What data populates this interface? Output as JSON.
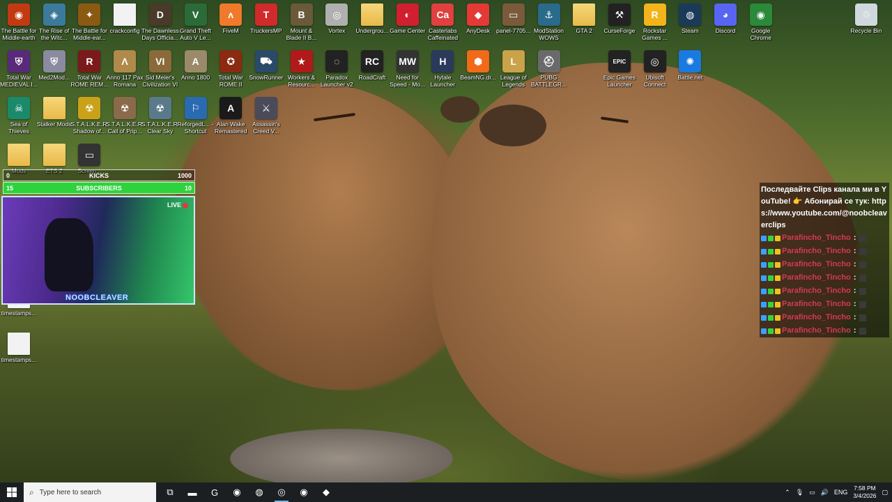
{
  "desktop": {
    "icons": [
      {
        "label": "The Battle for Middle-earth",
        "glyph": "◉",
        "color": "#c23a12"
      },
      {
        "label": "The Rise of the Witc...",
        "glyph": "◈",
        "color": "#3b7a9a"
      },
      {
        "label": "The Battle for Middle-ear...",
        "glyph": "✦",
        "color": "#8a5a12"
      },
      {
        "label": "crackconfig",
        "glyph": "",
        "color": "#f2f2f2",
        "kind": "file"
      },
      {
        "label": "The Dawnless Days Officia...",
        "glyph": "D",
        "color": "#4a3a2a"
      },
      {
        "label": "Grand Theft Auto V Le...",
        "glyph": "V",
        "color": "#2b6b3a"
      },
      {
        "label": "FiveM",
        "glyph": "ʌ",
        "color": "#f07a2a"
      },
      {
        "label": "TruckersMP",
        "glyph": "T",
        "color": "#d02a2a"
      },
      {
        "label": "Mount & Blade II B...",
        "glyph": "B",
        "color": "#6a5a3a"
      },
      {
        "label": "Vortex",
        "glyph": "◎",
        "color": "#b0b0b0"
      },
      {
        "label": "Undergrou...",
        "glyph": "",
        "color": "#e8b94a",
        "kind": "folder"
      },
      {
        "label": "Game Center",
        "glyph": "◐",
        "color": "#d02030"
      },
      {
        "label": "Casterlabs Caffeinated",
        "glyph": "Ca",
        "color": "#e04040"
      },
      {
        "label": "AnyDesk",
        "glyph": "◆",
        "color": "#e53935"
      },
      {
        "label": "panel-7705...",
        "glyph": "▭",
        "color": "#7a5a3a"
      },
      {
        "label": "ModStation WOWS",
        "glyph": "⚓",
        "color": "#2a6a8a"
      },
      {
        "label": "GTA 2",
        "glyph": "",
        "color": "#e8b94a",
        "kind": "folder"
      },
      {
        "label": "CurseForge",
        "glyph": "⚒",
        "color": "#222"
      },
      {
        "label": "Rockstar Games ...",
        "glyph": "R",
        "color": "#f2b41a"
      },
      {
        "label": "Steam",
        "glyph": "◍",
        "color": "#1b3a5a"
      },
      {
        "label": "Discord",
        "glyph": "◕",
        "color": "#5865f2"
      },
      {
        "label": "Google Chrome",
        "glyph": "◉",
        "color": "#2a8a3a"
      },
      {
        "label": "Recycle Bin",
        "glyph": "♲",
        "color": "#cfd8dc"
      },
      {
        "label": "Total War MEDIEVAL I...",
        "glyph": "⛨",
        "color": "#5a2a7a"
      },
      {
        "label": "Med2Mod...",
        "glyph": "⛨",
        "color": "#8a8aa0"
      },
      {
        "label": "Total War ROME REM...",
        "glyph": "R",
        "color": "#7a1a1a"
      },
      {
        "label": "Anno 117 Pax Romana",
        "glyph": "Λ",
        "color": "#b08a4a"
      },
      {
        "label": "Sid Meier's Civilization VI",
        "glyph": "VI",
        "color": "#8a6a3a"
      },
      {
        "label": "Anno 1800",
        "glyph": "A",
        "color": "#9a8a6a"
      },
      {
        "label": "Total War ROME II",
        "glyph": "✪",
        "color": "#8a2a12"
      },
      {
        "label": "SnowRunner",
        "glyph": "⛟",
        "color": "#2a4a6a"
      },
      {
        "label": "Workers & Resourc...",
        "glyph": "★",
        "color": "#b01a1a"
      },
      {
        "label": "Paradox Launcher v2",
        "glyph": "◌",
        "color": "#222"
      },
      {
        "label": "RoadCraft",
        "glyph": "RC",
        "color": "#222"
      },
      {
        "label": "Need for Speed - Mo...",
        "glyph": "MW",
        "color": "#333"
      },
      {
        "label": "Hytale Launcher",
        "glyph": "H",
        "color": "#2a3a5a"
      },
      {
        "label": "BeamNG.dr...",
        "glyph": "⬢",
        "color": "#f06a1a"
      },
      {
        "label": "League of Legends",
        "glyph": "L",
        "color": "#c9a24a"
      },
      {
        "label": "PUBG BATTLEGR...",
        "glyph": "⛑",
        "color": "#6a6a6a"
      },
      {
        "label": "Epic Games Launcher",
        "glyph": "EPIC",
        "color": "#222"
      },
      {
        "label": "Ubisoft Connect",
        "glyph": "◎",
        "color": "#222"
      },
      {
        "label": "Battle.net",
        "glyph": "✺",
        "color": "#1a7ae0"
      },
      {
        "label": "Sea of Thieves",
        "glyph": "☠",
        "color": "#1a8a6a"
      },
      {
        "label": "Stalker Mods",
        "glyph": "",
        "color": "#e8b94a",
        "kind": "folder"
      },
      {
        "label": "S.T.A.L.K.E.R. Shadow of...",
        "glyph": "☢",
        "color": "#c9a21a"
      },
      {
        "label": "S.T.A.L.K.E.R. Call of Prip...",
        "glyph": "☢",
        "color": "#8a6a4a"
      },
      {
        "label": "S.T.A.L.K.E.R. Clear Sky",
        "glyph": "☢",
        "color": "#5a7a8a"
      },
      {
        "label": "ReforgedL... - Shortcut",
        "glyph": "⚐",
        "color": "#2a6ab0"
      },
      {
        "label": "Alan Wake Remastered",
        "glyph": "A",
        "color": "#1a1a1a"
      },
      {
        "label": "Assassin's Creed V...",
        "glyph": "⚔",
        "color": "#4a4a5a"
      },
      {
        "label": "Mods",
        "glyph": "",
        "color": "#e8b94a",
        "kind": "folder"
      },
      {
        "label": "ETS 2",
        "glyph": "",
        "color": "#e8b94a",
        "kind": "folder"
      },
      {
        "label": "Screen...",
        "glyph": "▭",
        "color": "#333"
      },
      {
        "label": "timestamps...",
        "glyph": "",
        "color": "#f2f2f2",
        "kind": "file"
      },
      {
        "label": "timestamps...",
        "glyph": "",
        "color": "#f2f2f2",
        "kind": "file"
      }
    ]
  },
  "overlay": {
    "kicks": {
      "label": "KICKS",
      "current": "0",
      "goal": "1000"
    },
    "subscribers": {
      "label": "SUBSCRIBERS",
      "current": "15",
      "goal": "10"
    },
    "webcam": {
      "live_label": "LIVE",
      "channel_name": "NOOBCLEAVER"
    }
  },
  "chat": {
    "message": "Последвайте Clips канала ми в YouTube! 👉 Абонирай се тук: https://www.youtube.com/@noobcleaverclips",
    "rows": [
      {
        "user": "Parafincho_Tincho",
        "sep": ":"
      },
      {
        "user": "Parafincho_Tincho",
        "sep": ":"
      },
      {
        "user": "Parafincho_Tincho",
        "sep": ":"
      },
      {
        "user": "Parafincho_Tincho",
        "sep": ":"
      },
      {
        "user": "Parafincho_Tincho",
        "sep": ":"
      },
      {
        "user": "Parafincho_Tincho",
        "sep": ":"
      },
      {
        "user": "Parafincho_Tincho",
        "sep": ":"
      },
      {
        "user": "Parafincho_Tincho",
        "sep": ":"
      }
    ]
  },
  "taskbar": {
    "search_placeholder": "Type here to search",
    "apps": [
      {
        "name": "task-view-icon",
        "glyph": "⧉"
      },
      {
        "name": "file-explorer-icon",
        "glyph": "▬"
      },
      {
        "name": "github-icon",
        "glyph": "G"
      },
      {
        "name": "chrome-profile-icon",
        "glyph": "◉"
      },
      {
        "name": "steam-icon",
        "glyph": "◍"
      },
      {
        "name": "obs-icon",
        "glyph": "◎"
      },
      {
        "name": "chrome-icon",
        "glyph": "◉"
      },
      {
        "name": "app-icon",
        "glyph": "◆"
      }
    ],
    "language": "ENG",
    "time": "7:58 PM",
    "date": "3/4/2026"
  }
}
